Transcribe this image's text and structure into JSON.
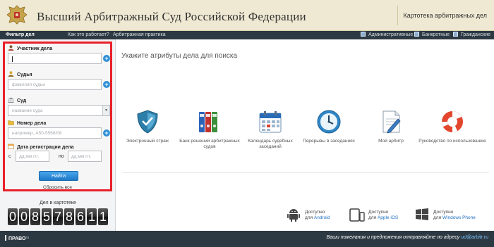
{
  "header": {
    "title": "Высший Арбитражный Суд Российской Федерации",
    "card_link": "Картотека арбитражных дел"
  },
  "nav": {
    "filter": "Фильтр дел",
    "how_it_works": "Как это работает?",
    "practice": "Арбитражная практика",
    "categories": [
      "Административные",
      "Банкротные",
      "Гражданские"
    ]
  },
  "form": {
    "participant_label": "Участник дела",
    "participant_value": "",
    "judge_label": "Судья",
    "judge_placeholder": "фамилия судьи",
    "court_label": "Суд",
    "court_placeholder": "название суда",
    "case_label": "Номер дела",
    "case_placeholder": "например, А50-5568/08",
    "date_label": "Дата регистрации дела",
    "from_label": "с",
    "to_label": "по",
    "date_placeholder": "дд.мм.ггг.",
    "find_button": "Найти",
    "reset_link": "Сбросить все"
  },
  "counter": {
    "title": "Дел в картотеке",
    "digits": [
      "0",
      "0",
      "8",
      "5",
      "7",
      "8",
      "6",
      "1",
      "1"
    ]
  },
  "main": {
    "prompt": "Укажите атрибуты дела для поиска",
    "tiles": [
      {
        "label": "Электронный страж",
        "icon": "shield-icon"
      },
      {
        "label": "Банк решений арбитражных судов",
        "icon": "binders-icon"
      },
      {
        "label": "Календарь судебных заседаний",
        "icon": "calendar-icon"
      },
      {
        "label": "Перерывы в заседаниях",
        "icon": "clock-icon"
      },
      {
        "label": "Мой арбитр",
        "icon": "document-pen-icon"
      },
      {
        "label": "Руководство по использованию",
        "icon": "lifebuoy-icon"
      }
    ],
    "platforms": [
      {
        "line1": "Доступно",
        "prefix": "для",
        "name": "Android",
        "icon": "android-icon"
      },
      {
        "line1": "Доступно",
        "prefix": "для",
        "name": "Apple iOS",
        "icon": "ios-devices-icon"
      },
      {
        "line1": "Доступно",
        "prefix": "для",
        "name": "Windows Phone",
        "icon": "windows-icon"
      }
    ]
  },
  "footer": {
    "logo": "ПРАВО",
    "logo_sup": "ru",
    "note": "Ваши пожелания и предложения отправляйте по адресу",
    "email": "ud@arbitr.ru"
  },
  "colors": {
    "highlight_border": "#e8202a",
    "nav_background": "#2d3942",
    "header_background": "#efe9d3",
    "accent_blue": "#2e8fd6"
  }
}
